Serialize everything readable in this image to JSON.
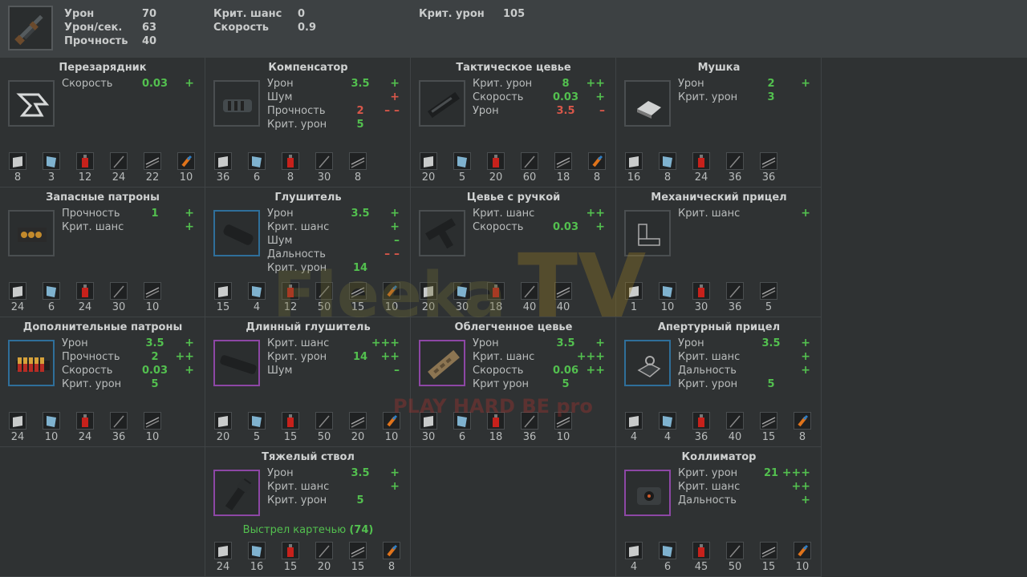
{
  "header": {
    "stats": [
      {
        "label": "Урон",
        "value": "70"
      },
      {
        "label": "Урон/сек.",
        "value": "63"
      },
      {
        "label": "Прочность",
        "value": "40"
      },
      {
        "label": "Крит. шанс",
        "value": "0"
      },
      {
        "label": "Скорость",
        "value": "0.9"
      },
      {
        "label": "Крит. урон",
        "value": "105"
      }
    ]
  },
  "mods": [
    {
      "title": "Перезарядник",
      "icon": "speedloader-icon",
      "frame": "grey",
      "stats": [
        {
          "name": "Скорость",
          "value": "0.03",
          "mark": "+",
          "color": "g"
        }
      ],
      "mats": [
        "8",
        "3",
        "12",
        "24",
        "22",
        "10"
      ]
    },
    {
      "title": "Компенсатор",
      "icon": "compensator-icon",
      "frame": "grey",
      "stats": [
        {
          "name": "Урон",
          "value": "3.5",
          "mark": "+",
          "color": "g"
        },
        {
          "name": "Шум",
          "value": "",
          "mark": "+",
          "color": "r"
        },
        {
          "name": "Прочность",
          "value": "2",
          "mark": "– –",
          "color": "r"
        },
        {
          "name": "Крит. урон",
          "value": "5",
          "mark": "",
          "color": "g"
        }
      ],
      "mats": [
        "36",
        "6",
        "8",
        "30",
        "8"
      ]
    },
    {
      "title": "Тактическое цевье",
      "icon": "tactical-forend-icon",
      "frame": "grey",
      "stats": [
        {
          "name": "Крит. урон",
          "value": "8",
          "mark": "++",
          "color": "g"
        },
        {
          "name": "Скорость",
          "value": "0.03",
          "mark": "+",
          "color": "g"
        },
        {
          "name": "Урон",
          "value": "3.5",
          "mark": "–",
          "color": "r"
        }
      ],
      "mats": [
        "20",
        "5",
        "20",
        "60",
        "18",
        "8"
      ]
    },
    {
      "title": "Мушка",
      "icon": "front-sight-icon",
      "frame": "grey",
      "stats": [
        {
          "name": "Урон",
          "value": "2",
          "mark": "+",
          "color": "g"
        },
        {
          "name": "Крит. урон",
          "value": "3",
          "mark": "",
          "color": "g"
        }
      ],
      "mats": [
        "16",
        "8",
        "24",
        "36",
        "36"
      ]
    },
    {
      "title": "Запасные патроны",
      "icon": "ammo-holder-icon",
      "frame": "grey",
      "stats": [
        {
          "name": "Прочность",
          "value": "1",
          "mark": "+",
          "color": "g"
        },
        {
          "name": "Крит. шанс",
          "value": "",
          "mark": "+",
          "color": "g"
        }
      ],
      "mats": [
        "24",
        "6",
        "24",
        "30",
        "10"
      ]
    },
    {
      "title": "Глушитель",
      "icon": "silencer-icon",
      "frame": "blue",
      "stats": [
        {
          "name": "Урон",
          "value": "3.5",
          "mark": "+",
          "color": "g"
        },
        {
          "name": "Крит. шанс",
          "value": "",
          "mark": "+",
          "color": "g"
        },
        {
          "name": "Шум",
          "value": "",
          "mark": "–",
          "color": "g"
        },
        {
          "name": "Дальность",
          "value": "",
          "mark": "– –",
          "color": "r"
        },
        {
          "name": "Крит. урон",
          "value": "14",
          "mark": "",
          "color": "g"
        }
      ],
      "mats": [
        "15",
        "4",
        "12",
        "50",
        "15",
        "10"
      ]
    },
    {
      "title": "Цевье с ручкой",
      "icon": "grip-forend-icon",
      "frame": "grey",
      "stats": [
        {
          "name": "Крит. шанс",
          "value": "",
          "mark": "++",
          "color": "g"
        },
        {
          "name": "Скорость",
          "value": "0.03",
          "mark": "+",
          "color": "g"
        }
      ],
      "mats": [
        "20",
        "30",
        "18",
        "40",
        "40"
      ]
    },
    {
      "title": "Механический прицел",
      "icon": "iron-sight-icon",
      "frame": "grey",
      "stats": [
        {
          "name": "Крит. шанс",
          "value": "",
          "mark": "+",
          "color": "g"
        }
      ],
      "mats": [
        "1",
        "10",
        "30",
        "36",
        "5"
      ]
    },
    {
      "title": "Дополнительные патроны",
      "icon": "extra-shells-icon",
      "frame": "blue",
      "stats": [
        {
          "name": "Урон",
          "value": "3.5",
          "mark": "+",
          "color": "g"
        },
        {
          "name": "Прочность",
          "value": "2",
          "mark": "++",
          "color": "g"
        },
        {
          "name": "Скорость",
          "value": "0.03",
          "mark": "+",
          "color": "g"
        },
        {
          "name": "Крит. урон",
          "value": "5",
          "mark": "",
          "color": "g"
        }
      ],
      "mats": [
        "24",
        "10",
        "24",
        "36",
        "10"
      ]
    },
    {
      "title": "Длинный глушитель",
      "icon": "long-silencer-icon",
      "frame": "purple",
      "stats": [
        {
          "name": "Крит. шанс",
          "value": "",
          "mark": "+++",
          "color": "g"
        },
        {
          "name": "Крит. урон",
          "value": "14",
          "mark": "++",
          "color": "g"
        },
        {
          "name": "Шум",
          "value": "",
          "mark": "–",
          "color": "g"
        }
      ],
      "mats": [
        "20",
        "5",
        "15",
        "50",
        "20",
        "10"
      ]
    },
    {
      "title": "Облегченное цевье",
      "icon": "light-forend-icon",
      "frame": "purple",
      "stats": [
        {
          "name": "Урон",
          "value": "3.5",
          "mark": "+",
          "color": "g"
        },
        {
          "name": "Крит. шанс",
          "value": "",
          "mark": "+++",
          "color": "g"
        },
        {
          "name": "Скорость",
          "value": "0.06",
          "mark": "++",
          "color": "g"
        },
        {
          "name": "Крит урон",
          "value": "5",
          "mark": "",
          "color": "g"
        }
      ],
      "mats": [
        "30",
        "6",
        "18",
        "36",
        "10"
      ]
    },
    {
      "title": "Апертурный прицел",
      "icon": "aperture-sight-icon",
      "frame": "blue",
      "stats": [
        {
          "name": "Урон",
          "value": "3.5",
          "mark": "+",
          "color": "g"
        },
        {
          "name": "Крит. шанс",
          "value": "",
          "mark": "+",
          "color": "g"
        },
        {
          "name": "Дальность",
          "value": "",
          "mark": "+",
          "color": "g"
        },
        {
          "name": "Крит. урон",
          "value": "5",
          "mark": "",
          "color": "g"
        }
      ],
      "mats": [
        "4",
        "4",
        "36",
        "40",
        "15",
        "8"
      ]
    },
    null,
    {
      "title": "Тяжелый ствол",
      "icon": "heavy-barrel-icon",
      "frame": "purple",
      "stats": [
        {
          "name": "Урон",
          "value": "3.5",
          "mark": "+",
          "color": "g"
        },
        {
          "name": "Крит. шанс",
          "value": "",
          "mark": "+",
          "color": "g"
        },
        {
          "name": "Крит. урон",
          "value": "5",
          "mark": "",
          "color": "g"
        }
      ],
      "note_text": "Выстрел картечью",
      "note_value": "(74)",
      "mats": [
        "24",
        "16",
        "15",
        "20",
        "15",
        "8"
      ]
    },
    null,
    {
      "title": "Коллиматор",
      "icon": "collimator-icon",
      "frame": "purple",
      "stats": [
        {
          "name": "Крит. урон",
          "value": "21",
          "mark": "+++",
          "color": "g"
        },
        {
          "name": "Крит. шанс",
          "value": "",
          "mark": "++",
          "color": "g"
        },
        {
          "name": "Дальность",
          "value": "",
          "mark": "+",
          "color": "g"
        }
      ],
      "mats": [
        "4",
        "6",
        "45",
        "50",
        "15",
        "10"
      ]
    }
  ],
  "watermark": {
    "brand": "Fleeka TV",
    "slogan": "PLAY HARD BE pro"
  }
}
